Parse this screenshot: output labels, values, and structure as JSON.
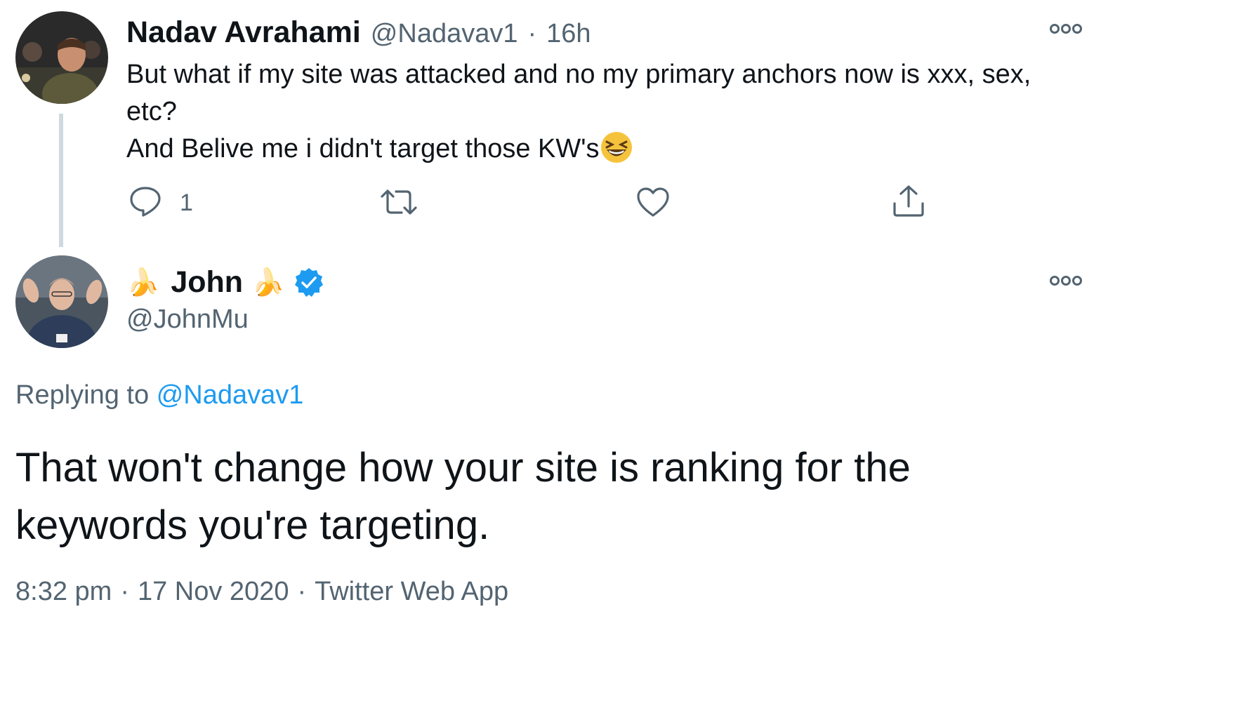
{
  "parent_tweet": {
    "author_name": "Nadav Avrahami",
    "handle": "@Nadavav1",
    "separator": "·",
    "time": "16h",
    "text_line_1": "But what if my site was attacked and no my primary anchors now is xxx, sex,",
    "text_line_2": "etc?",
    "text_line_3": "And Belive me i didn't target those KW's",
    "emoji": "😆",
    "reply_count": "1"
  },
  "main_tweet": {
    "author_name": "John",
    "name_emoji": "🍌",
    "handle": "@JohnMu",
    "replying_to_label": "Replying to",
    "replying_to_handle": "@Nadavav1",
    "text_line_1": "That won't change how your site is ranking for the",
    "text_line_2": "keywords you're targeting.",
    "timestamp": "8:32 pm",
    "date": "17 Nov 2020",
    "source": "Twitter Web App",
    "sep": "·"
  },
  "icons": {
    "more": "more-horizontal-icon",
    "reply": "reply-icon",
    "retweet": "retweet-icon",
    "like": "heart-icon",
    "share": "share-icon",
    "verified": "verified-badge-icon"
  },
  "colors": {
    "link": "#1d9bf0",
    "verified": "#1d9bf0",
    "muted": "#536471",
    "thread_line": "#cfd9de"
  }
}
